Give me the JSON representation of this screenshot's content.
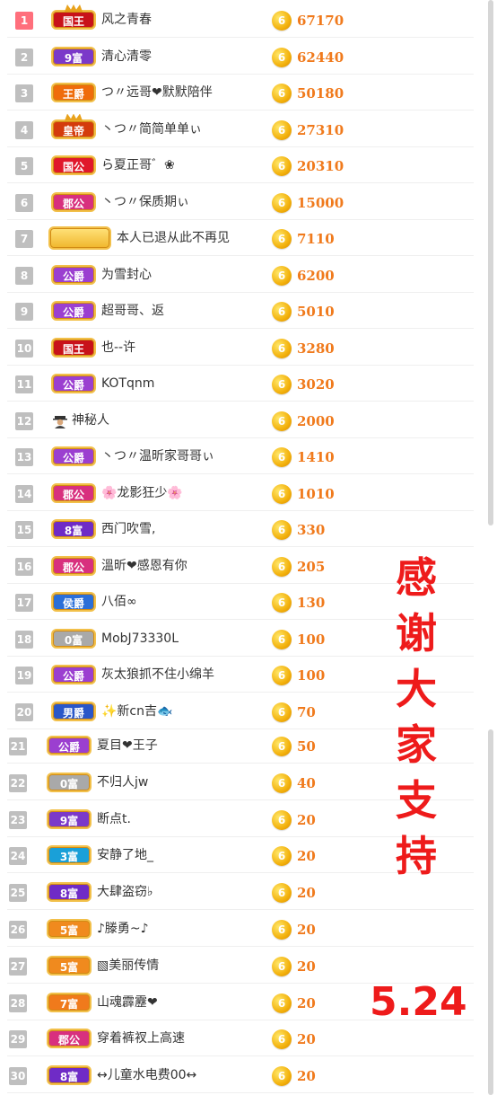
{
  "thanks_text": "感谢大家支持",
  "date_text": "5.24",
  "coin_symbol": "6",
  "colors": {
    "accent_red": "#ee1b1b",
    "value_orange": "#f07a1c",
    "rank_top": "#ff6f7c",
    "rank_gray": "#bfbfbf"
  },
  "entries": [
    {
      "rank": "1",
      "badge": "国王",
      "badge_color": "#c8121a",
      "crown": true,
      "name": "风之青春",
      "value": "67170"
    },
    {
      "rank": "2",
      "badge": "9富",
      "badge_color": "#7b39c9",
      "crown": false,
      "name": "清心清零",
      "value": "62440"
    },
    {
      "rank": "3",
      "badge": "王爵",
      "badge_color": "#ef6c0b",
      "crown": false,
      "name": "つ〃远哥❤默默陪伴",
      "value": "50180"
    },
    {
      "rank": "4",
      "badge": "皇帝",
      "badge_color": "#d43b0c",
      "crown": true,
      "name": "丶つ〃简简单单ぃ",
      "value": "27310"
    },
    {
      "rank": "5",
      "badge": "国公",
      "badge_color": "#e0182b",
      "crown": false,
      "name": "ら夏正哥゛❀",
      "value": "20310"
    },
    {
      "rank": "6",
      "badge": "郡公",
      "badge_color": "#d8307e",
      "crown": false,
      "name": "丶つ〃保质期ぃ",
      "value": "15000"
    },
    {
      "rank": "7",
      "badge": "",
      "badge_color": "#f0c447",
      "crown": false,
      "name": "本人已退从此不再见",
      "value": "7110"
    },
    {
      "rank": "8",
      "badge": "公爵",
      "badge_color": "#9b3fd0",
      "crown": false,
      "name": "为雪封心",
      "value": "6200"
    },
    {
      "rank": "9",
      "badge": "公爵",
      "badge_color": "#9b3fd0",
      "crown": false,
      "name": "超哥哥、返",
      "value": "5010"
    },
    {
      "rank": "10",
      "badge": "国王",
      "badge_color": "#c8121a",
      "crown": false,
      "name": "也--许",
      "value": "3280"
    },
    {
      "rank": "11",
      "badge": "公爵",
      "badge_color": "#9b3fd0",
      "crown": false,
      "name": "KOTqnm",
      "value": "3020"
    },
    {
      "rank": "12",
      "badge": "",
      "badge_color": "",
      "crown": false,
      "name": "神秘人",
      "value": "2000",
      "avatar": true
    },
    {
      "rank": "13",
      "badge": "公爵",
      "badge_color": "#9b3fd0",
      "crown": false,
      "name": "丶つ〃温昕家哥哥ぃ",
      "value": "1410"
    },
    {
      "rank": "14",
      "badge": "郡公",
      "badge_color": "#d8307e",
      "crown": false,
      "name": "🌸龙影狂少🌸",
      "value": "1010"
    },
    {
      "rank": "15",
      "badge": "8富",
      "badge_color": "#6f2bc6",
      "crown": false,
      "name": "西门吹雪,",
      "value": "330"
    },
    {
      "rank": "16",
      "badge": "郡公",
      "badge_color": "#d8307e",
      "crown": false,
      "name": "溫昕❤感恩有你",
      "value": "205"
    },
    {
      "rank": "17",
      "badge": "侯爵",
      "badge_color": "#2b6fd8",
      "crown": false,
      "name": "八佰∞",
      "value": "130"
    },
    {
      "rank": "18",
      "badge": "0富",
      "badge_color": "#a9a9a9",
      "crown": false,
      "name": "MobJ73330L",
      "value": "100"
    },
    {
      "rank": "19",
      "badge": "公爵",
      "badge_color": "#9b3fd0",
      "crown": false,
      "name": "灰太狼抓不住小绵羊",
      "value": "100"
    },
    {
      "rank": "20",
      "badge": "男爵",
      "badge_color": "#2a57c8",
      "crown": false,
      "name": "✨新cn吉🐟",
      "value": "70"
    },
    {
      "rank": "21",
      "badge": "公爵",
      "badge_color": "#9b3fd0",
      "crown": false,
      "name": "夏目❤王子",
      "value": "50"
    },
    {
      "rank": "22",
      "badge": "0富",
      "badge_color": "#a9a9a9",
      "crown": false,
      "name": "不归人jw",
      "value": "40"
    },
    {
      "rank": "23",
      "badge": "9富",
      "badge_color": "#7b39c9",
      "crown": false,
      "name": "断点t.",
      "value": "20"
    },
    {
      "rank": "24",
      "badge": "3富",
      "badge_color": "#1aa0d8",
      "crown": false,
      "name": "安静了地_",
      "value": "20"
    },
    {
      "rank": "25",
      "badge": "8富",
      "badge_color": "#6f2bc6",
      "crown": false,
      "name": "大肆盗窃♭",
      "value": "20"
    },
    {
      "rank": "26",
      "badge": "5富",
      "badge_color": "#f08a1e",
      "crown": false,
      "name": "♪滕勇~♪",
      "value": "20"
    },
    {
      "rank": "27",
      "badge": "5富",
      "badge_color": "#f08a1e",
      "crown": false,
      "name": "▧美丽传情",
      "value": "20"
    },
    {
      "rank": "28",
      "badge": "7富",
      "badge_color": "#f07a1c",
      "crown": false,
      "name": "山魂霹靂❤",
      "value": "20"
    },
    {
      "rank": "29",
      "badge": "郡公",
      "badge_color": "#d8307e",
      "crown": false,
      "name": "穿着裤衩上高速",
      "value": "20"
    },
    {
      "rank": "30",
      "badge": "8富",
      "badge_color": "#6f2bc6",
      "crown": false,
      "name": "↔儿童水电费00↔",
      "value": "20"
    }
  ]
}
